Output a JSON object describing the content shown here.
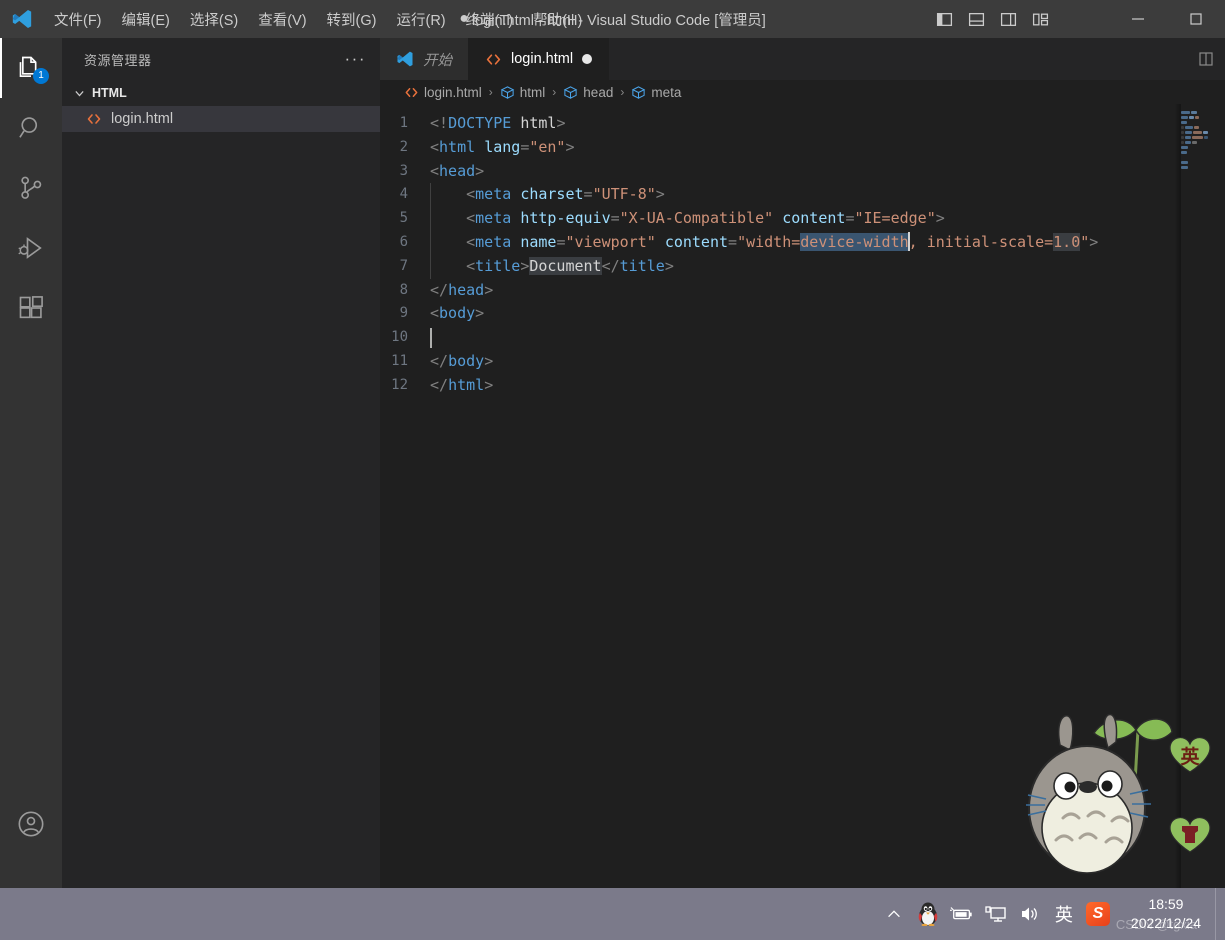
{
  "titlebar": {
    "logo_icon": "vscode-logo-icon",
    "menus": [
      {
        "label": "文件(F)",
        "mnemonic": "F"
      },
      {
        "label": "编辑(E)",
        "mnemonic": "E"
      },
      {
        "label": "选择(S)",
        "mnemonic": "S"
      },
      {
        "label": "查看(V)",
        "mnemonic": "V"
      },
      {
        "label": "转到(G)",
        "mnemonic": "G"
      },
      {
        "label": "运行(R)",
        "mnemonic": "R"
      },
      {
        "label": "终端(T)",
        "mnemonic": "T"
      },
      {
        "label": "帮助(H)",
        "mnemonic": "H"
      }
    ],
    "dirty_indicator": "●",
    "window_title": "login.html - html - Visual Studio Code [管理员]",
    "layout_buttons": [
      {
        "name": "toggle-primary-sidebar",
        "icon": "panel-left-icon"
      },
      {
        "name": "toggle-panel",
        "icon": "panel-bottom-icon"
      },
      {
        "name": "toggle-secondary-sidebar",
        "icon": "panel-right-icon"
      },
      {
        "name": "customize-layout",
        "icon": "layout-grid-icon"
      }
    ],
    "window_controls": [
      {
        "name": "minimize",
        "icon": "minimize-icon",
        "glyph": "—"
      },
      {
        "name": "maximize",
        "icon": "maximize-icon",
        "glyph": "▢"
      }
    ]
  },
  "activitybar": {
    "items": [
      {
        "name": "explorer",
        "icon": "files-icon",
        "active": true,
        "badge": "1"
      },
      {
        "name": "search",
        "icon": "search-icon",
        "active": false,
        "badge": ""
      },
      {
        "name": "source-control",
        "icon": "source-control-icon",
        "active": false,
        "badge": ""
      },
      {
        "name": "run-and-debug",
        "icon": "run-debug-icon",
        "active": false,
        "badge": ""
      },
      {
        "name": "extensions",
        "icon": "extensions-icon",
        "active": false,
        "badge": ""
      }
    ],
    "account_icon": "account-icon"
  },
  "sidebar": {
    "title": "资源管理器",
    "more_actions": "···",
    "section": {
      "label": "HTML",
      "expanded": true,
      "chevron": "chevron-down-icon"
    },
    "files": [
      {
        "name": "login.html",
        "icon": "html-file-icon",
        "selected": true
      }
    ]
  },
  "editor": {
    "tabs": [
      {
        "label": "开始",
        "icon": "vscode-logo-icon",
        "active": false,
        "dirty": false
      },
      {
        "label": "login.html",
        "icon": "html-file-icon",
        "active": true,
        "dirty": true
      }
    ],
    "breadcrumb": [
      {
        "label": "login.html",
        "icon": "html-file-icon"
      },
      {
        "label": "html",
        "icon": "symbol-field-icon"
      },
      {
        "label": "head",
        "icon": "symbol-field-icon"
      },
      {
        "label": "meta",
        "icon": "symbol-field-icon"
      }
    ],
    "breadcrumb_separator": "›",
    "language": "html",
    "lines": [
      {
        "num": "1",
        "text": "<!DOCTYPE html>"
      },
      {
        "num": "2",
        "text": "<html lang=\"en\">"
      },
      {
        "num": "3",
        "text": "<head>"
      },
      {
        "num": "4",
        "text": "    <meta charset=\"UTF-8\">"
      },
      {
        "num": "5",
        "text": "    <meta http-equiv=\"X-UA-Compatible\" content=\"IE=edge\">"
      },
      {
        "num": "6",
        "text": "    <meta name=\"viewport\" content=\"width=device-width, initial-scale=1.0\">"
      },
      {
        "num": "7",
        "text": "    <title>Document</title>"
      },
      {
        "num": "8",
        "text": "</head>"
      },
      {
        "num": "9",
        "text": "<body>"
      },
      {
        "num": "10",
        "text": "    "
      },
      {
        "num": "11",
        "text": "</body>"
      },
      {
        "num": "12",
        "text": "</html>"
      }
    ],
    "selection_text": "device-width",
    "word_highlights": [
      "1.0",
      "Document"
    ],
    "cursor_line": "10"
  },
  "ime_overlay": {
    "skin_name": "totoro-skin",
    "badges": [
      {
        "label": "英",
        "name": "ime-mode-english-badge"
      },
      {
        "label": "",
        "name": "ime-shortcut-badge"
      }
    ]
  },
  "taskbar": {
    "tray": [
      {
        "name": "show-hidden-icons",
        "icon": "chevron-up-icon"
      },
      {
        "name": "qq-tray",
        "icon": "qq-penguin-icon"
      },
      {
        "name": "battery-tray",
        "icon": "battery-icon"
      },
      {
        "name": "network-tray",
        "icon": "network-icon"
      },
      {
        "name": "volume-tray",
        "icon": "volume-icon"
      }
    ],
    "ime_indicator": "英",
    "sogou_label": "S",
    "time": "18:59",
    "date": "2022/12/24",
    "watermark": "CSDN @tgxia"
  },
  "colors": {
    "accent": "#0078d4",
    "titlebar_bg": "#3c3c3c",
    "activitybar_bg": "#333333",
    "sidebar_bg": "#252526",
    "editor_bg": "#1f1f1f",
    "taskbar_bg": "#7b7a8a",
    "tag": "#569cd6",
    "attribute": "#9cdcfe",
    "string": "#ce9178",
    "selection": "#3a5570",
    "word_highlight": "#3a3d41",
    "html_icon": "#e44d26"
  }
}
